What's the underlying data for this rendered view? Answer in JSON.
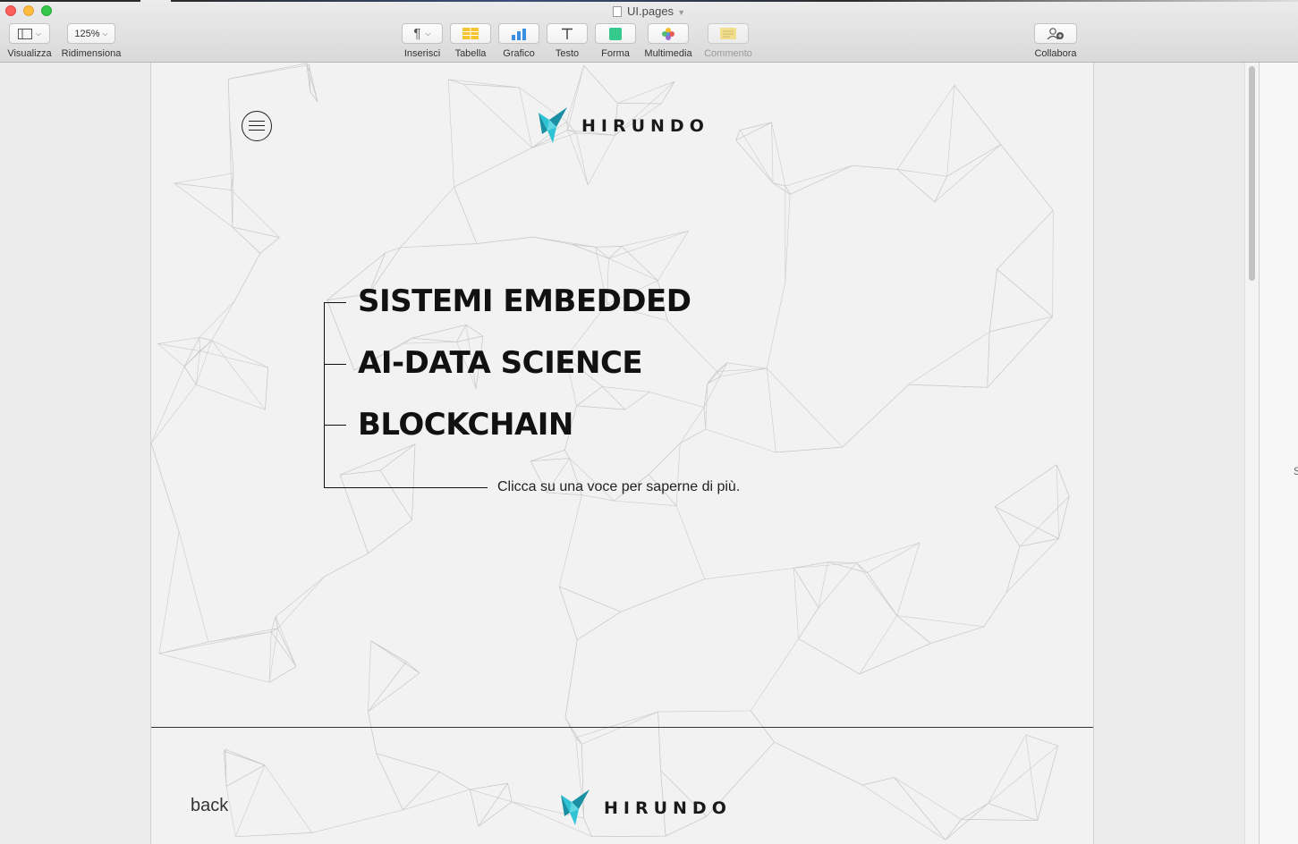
{
  "window": {
    "document_title": "UI.pages",
    "doc_icon": "pages-document-icon"
  },
  "toolbar": {
    "view": {
      "label": "Visualizza",
      "icon": "sidebar-view-icon"
    },
    "zoom": {
      "label": "Ridimensiona",
      "value": "125%"
    },
    "insert": {
      "label": "Inserisci",
      "icon": "pilcrow-icon"
    },
    "table": {
      "label": "Tabella",
      "icon": "table-icon"
    },
    "chart": {
      "label": "Grafico",
      "icon": "bar-chart-icon"
    },
    "text": {
      "label": "Testo",
      "icon": "text-icon"
    },
    "shape": {
      "label": "Forma",
      "icon": "shape-icon"
    },
    "media": {
      "label": "Multimedia",
      "icon": "photos-icon"
    },
    "comment": {
      "label": "Commento",
      "icon": "comment-icon"
    },
    "collaborate": {
      "label": "Collabora",
      "icon": "add-person-icon"
    }
  },
  "page": {
    "brand": "HIRUNDO",
    "menu_items": [
      "SISTEMI EMBEDDED",
      "AI-DATA SCIENCE",
      "BLOCKCHAIN"
    ],
    "hint": "Clicca su una voce per saperne di più.",
    "back_label": "back"
  },
  "side_panel": {
    "edge_text": "S"
  },
  "colors": {
    "logo_teal": "#2ec4d6",
    "logo_dark_teal": "#1b8fa3",
    "text_dark": "#111111",
    "page_bg": "#f2f2f2"
  }
}
